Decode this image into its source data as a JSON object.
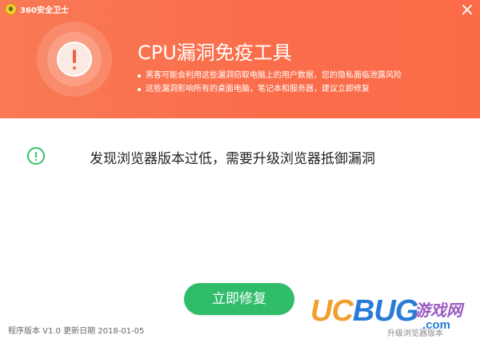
{
  "app": {
    "title": "360安全卫士",
    "close_glyph": "×"
  },
  "header": {
    "title": "CPU漏洞免疫工具",
    "bullets": [
      "黑客可能会利用这些漏洞窃取电脑上的用户数据，您的隐私面临泄露风险",
      "这些漏洞影响所有的桌面电脑，笔记本和服务器，建议立即修复"
    ],
    "icon": "warning-exclamation-icon"
  },
  "result": {
    "icon": "info-circle-icon",
    "message": "发现浏览器版本过低，需要升级浏览器抵御漏洞"
  },
  "actions": {
    "fix_label": "立即修复"
  },
  "footer": {
    "version_text": "程序版本 V1.0 更新日期 2018-01-05"
  },
  "watermark": {
    "uc": "UC",
    "bug": "BUG",
    "cn": "游戏网",
    "com": ".com",
    "behind_text": "升级浏览器版本"
  },
  "colors": {
    "header_bg": "#fa6d4b",
    "accent_green": "#2fbd6a",
    "icon_green": "#34c46a"
  }
}
